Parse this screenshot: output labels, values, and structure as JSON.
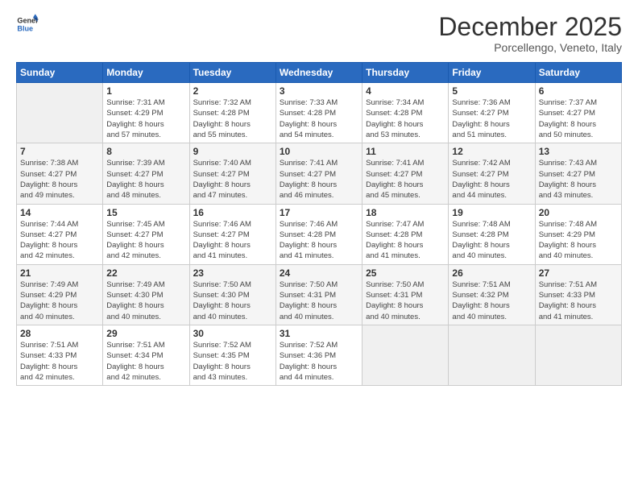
{
  "header": {
    "title": "December 2025",
    "location": "Porcellengo, Veneto, Italy"
  },
  "columns": [
    "Sunday",
    "Monday",
    "Tuesday",
    "Wednesday",
    "Thursday",
    "Friday",
    "Saturday"
  ],
  "weeks": [
    [
      {
        "num": "",
        "info": ""
      },
      {
        "num": "1",
        "info": "Sunrise: 7:31 AM\nSunset: 4:29 PM\nDaylight: 8 hours\nand 57 minutes."
      },
      {
        "num": "2",
        "info": "Sunrise: 7:32 AM\nSunset: 4:28 PM\nDaylight: 8 hours\nand 55 minutes."
      },
      {
        "num": "3",
        "info": "Sunrise: 7:33 AM\nSunset: 4:28 PM\nDaylight: 8 hours\nand 54 minutes."
      },
      {
        "num": "4",
        "info": "Sunrise: 7:34 AM\nSunset: 4:28 PM\nDaylight: 8 hours\nand 53 minutes."
      },
      {
        "num": "5",
        "info": "Sunrise: 7:36 AM\nSunset: 4:27 PM\nDaylight: 8 hours\nand 51 minutes."
      },
      {
        "num": "6",
        "info": "Sunrise: 7:37 AM\nSunset: 4:27 PM\nDaylight: 8 hours\nand 50 minutes."
      }
    ],
    [
      {
        "num": "7",
        "info": "Sunrise: 7:38 AM\nSunset: 4:27 PM\nDaylight: 8 hours\nand 49 minutes."
      },
      {
        "num": "8",
        "info": "Sunrise: 7:39 AM\nSunset: 4:27 PM\nDaylight: 8 hours\nand 48 minutes."
      },
      {
        "num": "9",
        "info": "Sunrise: 7:40 AM\nSunset: 4:27 PM\nDaylight: 8 hours\nand 47 minutes."
      },
      {
        "num": "10",
        "info": "Sunrise: 7:41 AM\nSunset: 4:27 PM\nDaylight: 8 hours\nand 46 minutes."
      },
      {
        "num": "11",
        "info": "Sunrise: 7:41 AM\nSunset: 4:27 PM\nDaylight: 8 hours\nand 45 minutes."
      },
      {
        "num": "12",
        "info": "Sunrise: 7:42 AM\nSunset: 4:27 PM\nDaylight: 8 hours\nand 44 minutes."
      },
      {
        "num": "13",
        "info": "Sunrise: 7:43 AM\nSunset: 4:27 PM\nDaylight: 8 hours\nand 43 minutes."
      }
    ],
    [
      {
        "num": "14",
        "info": "Sunrise: 7:44 AM\nSunset: 4:27 PM\nDaylight: 8 hours\nand 42 minutes."
      },
      {
        "num": "15",
        "info": "Sunrise: 7:45 AM\nSunset: 4:27 PM\nDaylight: 8 hours\nand 42 minutes."
      },
      {
        "num": "16",
        "info": "Sunrise: 7:46 AM\nSunset: 4:27 PM\nDaylight: 8 hours\nand 41 minutes."
      },
      {
        "num": "17",
        "info": "Sunrise: 7:46 AM\nSunset: 4:28 PM\nDaylight: 8 hours\nand 41 minutes."
      },
      {
        "num": "18",
        "info": "Sunrise: 7:47 AM\nSunset: 4:28 PM\nDaylight: 8 hours\nand 41 minutes."
      },
      {
        "num": "19",
        "info": "Sunrise: 7:48 AM\nSunset: 4:28 PM\nDaylight: 8 hours\nand 40 minutes."
      },
      {
        "num": "20",
        "info": "Sunrise: 7:48 AM\nSunset: 4:29 PM\nDaylight: 8 hours\nand 40 minutes."
      }
    ],
    [
      {
        "num": "21",
        "info": "Sunrise: 7:49 AM\nSunset: 4:29 PM\nDaylight: 8 hours\nand 40 minutes."
      },
      {
        "num": "22",
        "info": "Sunrise: 7:49 AM\nSunset: 4:30 PM\nDaylight: 8 hours\nand 40 minutes."
      },
      {
        "num": "23",
        "info": "Sunrise: 7:50 AM\nSunset: 4:30 PM\nDaylight: 8 hours\nand 40 minutes."
      },
      {
        "num": "24",
        "info": "Sunrise: 7:50 AM\nSunset: 4:31 PM\nDaylight: 8 hours\nand 40 minutes."
      },
      {
        "num": "25",
        "info": "Sunrise: 7:50 AM\nSunset: 4:31 PM\nDaylight: 8 hours\nand 40 minutes."
      },
      {
        "num": "26",
        "info": "Sunrise: 7:51 AM\nSunset: 4:32 PM\nDaylight: 8 hours\nand 40 minutes."
      },
      {
        "num": "27",
        "info": "Sunrise: 7:51 AM\nSunset: 4:33 PM\nDaylight: 8 hours\nand 41 minutes."
      }
    ],
    [
      {
        "num": "28",
        "info": "Sunrise: 7:51 AM\nSunset: 4:33 PM\nDaylight: 8 hours\nand 42 minutes."
      },
      {
        "num": "29",
        "info": "Sunrise: 7:51 AM\nSunset: 4:34 PM\nDaylight: 8 hours\nand 42 minutes."
      },
      {
        "num": "30",
        "info": "Sunrise: 7:52 AM\nSunset: 4:35 PM\nDaylight: 8 hours\nand 43 minutes."
      },
      {
        "num": "31",
        "info": "Sunrise: 7:52 AM\nSunset: 4:36 PM\nDaylight: 8 hours\nand 44 minutes."
      },
      {
        "num": "",
        "info": ""
      },
      {
        "num": "",
        "info": ""
      },
      {
        "num": "",
        "info": ""
      }
    ]
  ]
}
